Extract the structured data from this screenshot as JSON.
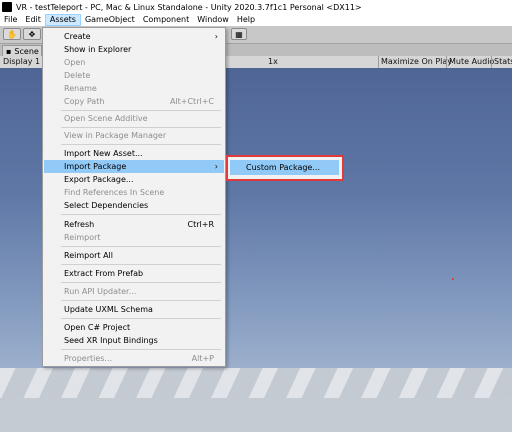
{
  "window": {
    "title": "VR - testTeleport - PC, Mac & Linux Standalone - Unity 2020.3.7f1c1 Personal <DX11>"
  },
  "menubar": [
    "File",
    "Edit",
    "Assets",
    "GameObject",
    "Component",
    "Window",
    "Help"
  ],
  "scene_tab": {
    "label": "Scene"
  },
  "game_bar": {
    "display": "Display 1",
    "scale": "1x",
    "maximize": "Maximize On Play",
    "mute": "Mute Audio",
    "stats": "Stats"
  },
  "assets_menu": {
    "items": [
      {
        "label": "Create",
        "submenu": true
      },
      {
        "label": "Show in Explorer"
      },
      {
        "label": "Open",
        "disabled": true
      },
      {
        "label": "Delete",
        "disabled": true
      },
      {
        "label": "Rename",
        "disabled": true
      },
      {
        "label": "Copy Path",
        "shortcut": "Alt+Ctrl+C",
        "disabled": true
      },
      {
        "label": "Open Scene Additive",
        "disabled": true
      },
      {
        "label": "View in Package Manager",
        "disabled": true
      },
      {
        "label": "Import New Asset..."
      },
      {
        "label": "Import Package",
        "submenu": true,
        "highlighted": true
      },
      {
        "label": "Export Package..."
      },
      {
        "label": "Find References In Scene",
        "disabled": true
      },
      {
        "label": "Select Dependencies"
      },
      {
        "label": "Refresh",
        "shortcut": "Ctrl+R"
      },
      {
        "label": "Reimport",
        "disabled": true
      },
      {
        "label": "Reimport All"
      },
      {
        "label": "Extract From Prefab"
      },
      {
        "label": "Run API Updater...",
        "disabled": true
      },
      {
        "label": "Update UXML Schema"
      },
      {
        "label": "Open C# Project"
      },
      {
        "label": "Seed XR Input Bindings"
      },
      {
        "label": "Properties...",
        "shortcut": "Alt+P",
        "disabled": true
      }
    ],
    "submenu_arrow": "›"
  },
  "import_package_submenu": {
    "items": [
      {
        "label": "Custom Package..."
      }
    ]
  }
}
